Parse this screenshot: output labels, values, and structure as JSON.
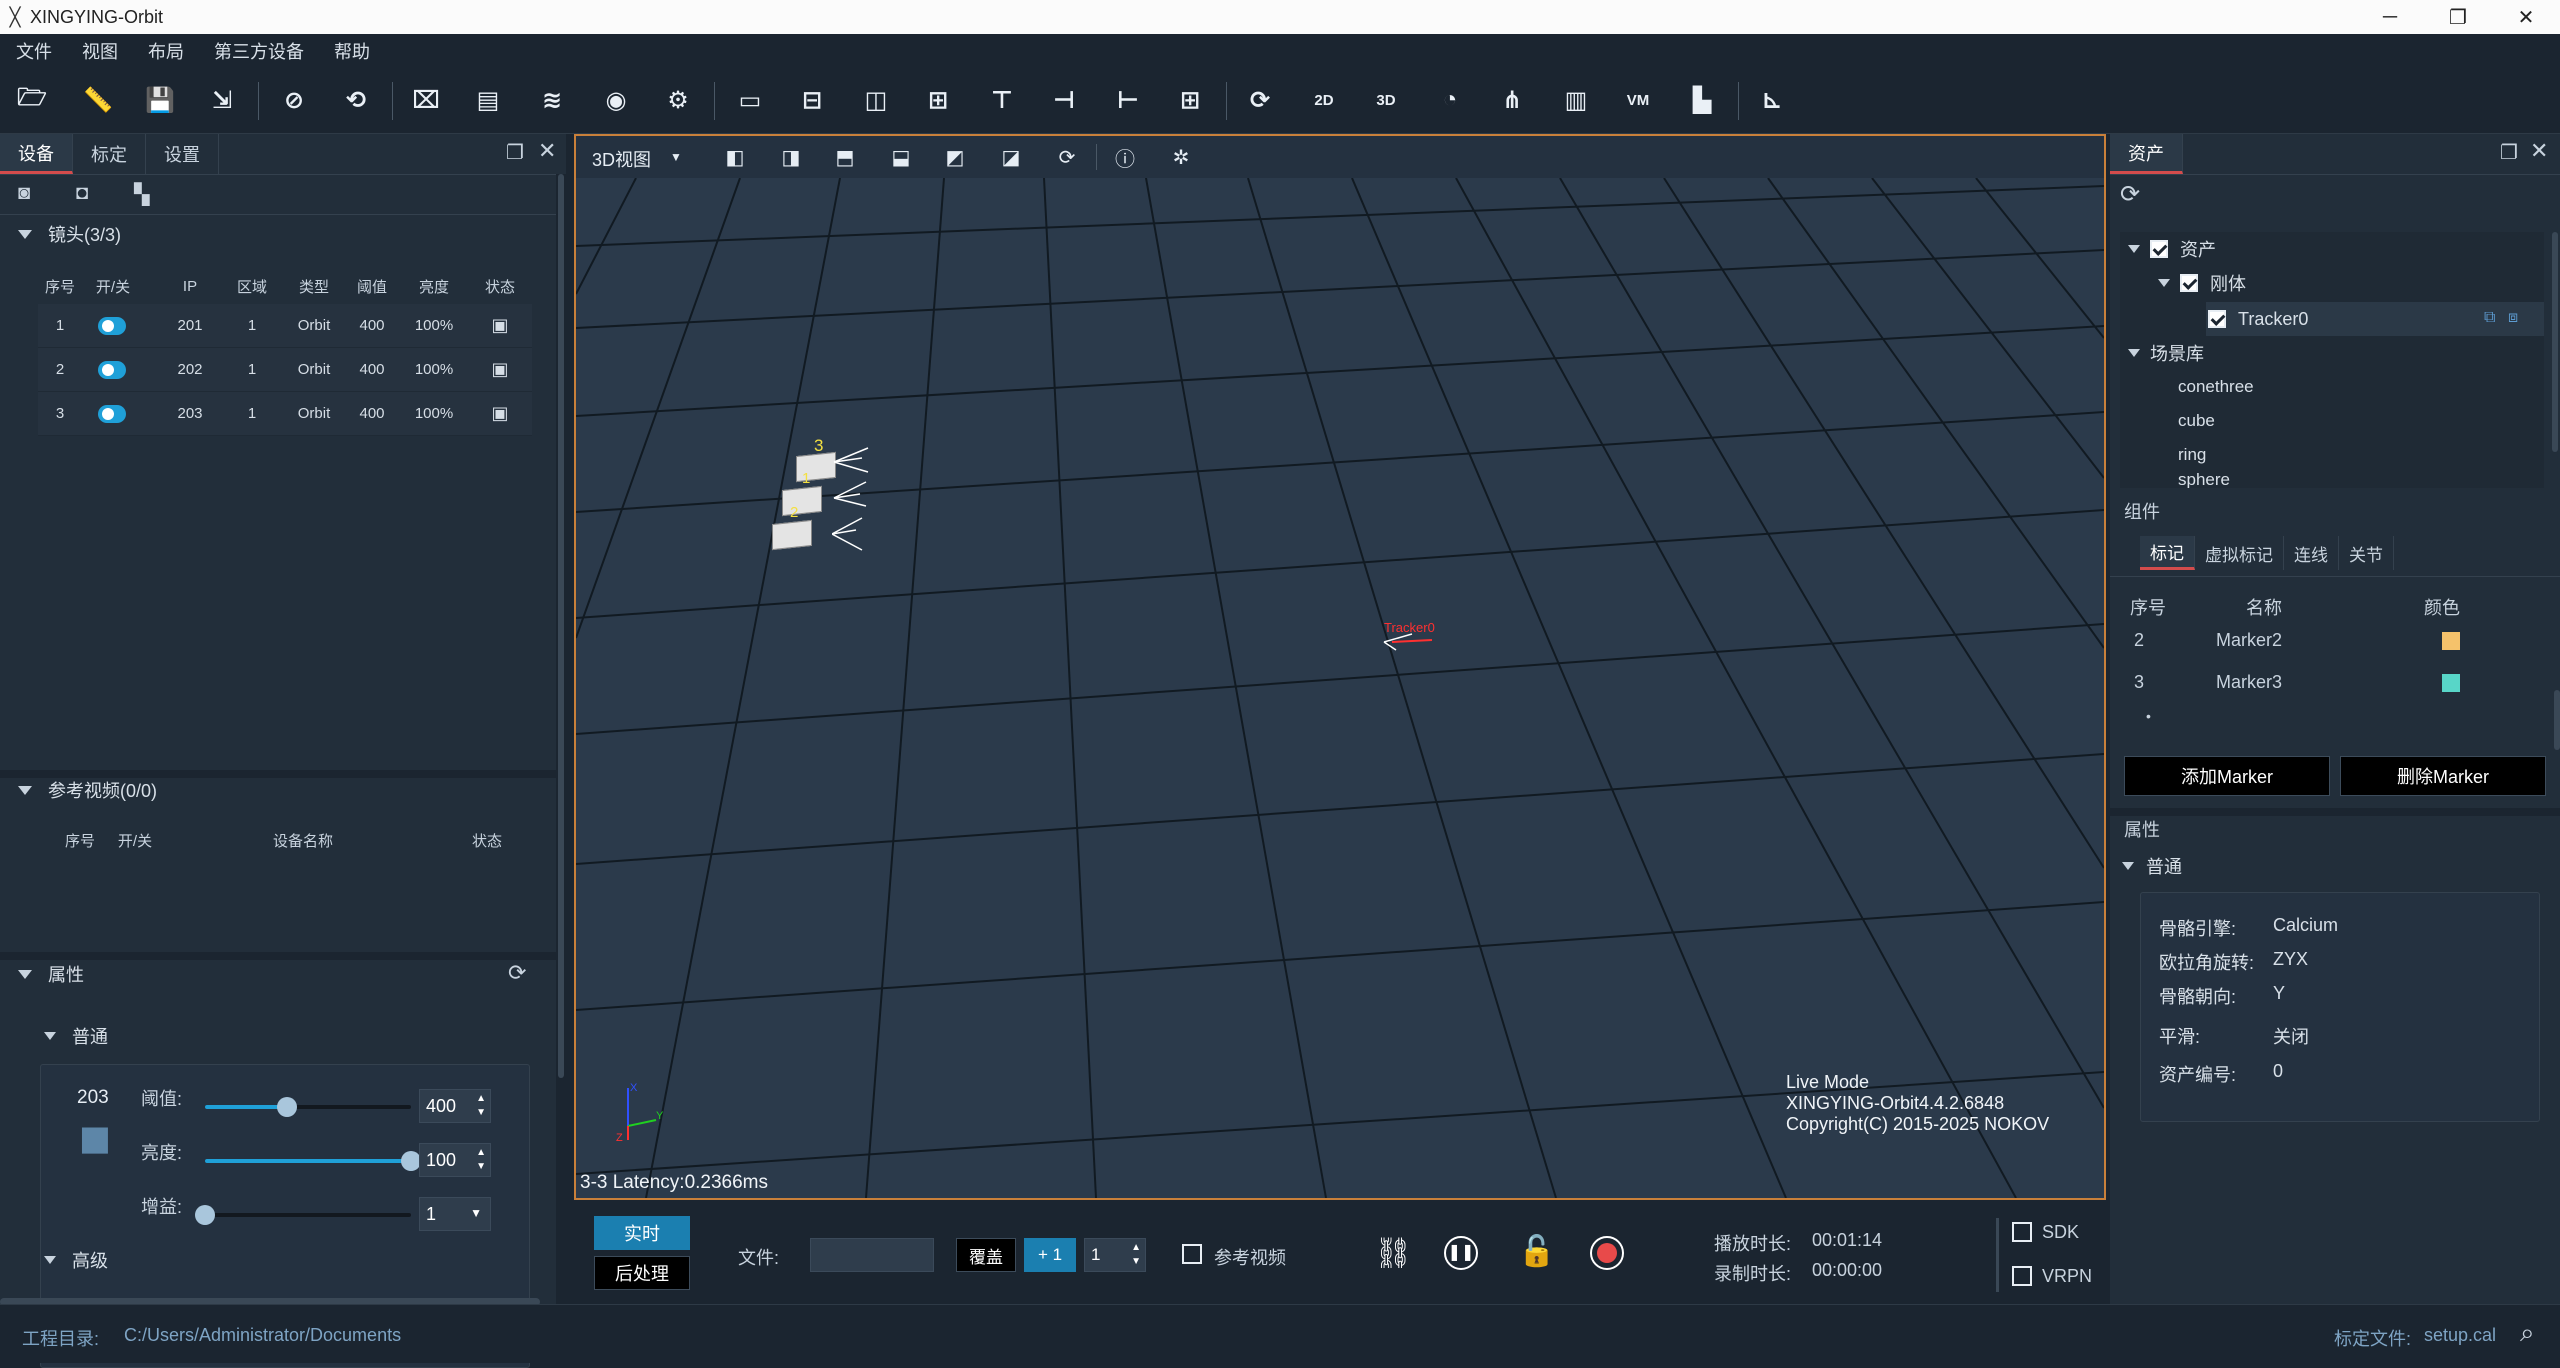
{
  "app": {
    "title": "XINGYING-Orbit"
  },
  "menu": [
    "文件",
    "视图",
    "布局",
    "第三方设备",
    "帮助"
  ],
  "toolbar_icons": [
    "open-folder-icon",
    "ruler-icon",
    "save-icon",
    "save-as-icon",
    "hide-icon",
    "rotate-device-icon",
    "camera-off-icon",
    "calibration-bar-icon",
    "layers-icon",
    "wireless-icon",
    "settings-icon",
    "layout-single-icon",
    "layout-split-h-icon",
    "layout-split-v-icon",
    "layout-grid-a-icon",
    "layout-grid-b-icon",
    "layout-grid-c-icon",
    "layout-grid-d-icon",
    "layout-quad-icon",
    "camera-refresh-icon",
    "view-2d-icon",
    "view-3d-icon",
    "gauge-icon",
    "graph-icon",
    "bar-chart-icon",
    "vm-icon",
    "file-icon",
    "axis-icon"
  ],
  "toolbar_text": {
    "view2d": "2D",
    "view3d": "3D",
    "vm": "VM"
  },
  "left": {
    "tabs": [
      "设备",
      "标定",
      "设置"
    ],
    "cameras_title": "镜头(3/3)",
    "cam_headers": [
      "序号",
      "开/关",
      "IP",
      "区域",
      "类型",
      "阈值",
      "亮度",
      "状态"
    ],
    "cameras": [
      {
        "no": "1",
        "ip": "201",
        "zone": "1",
        "type": "Orbit",
        "threshold": "400",
        "brightness": "100%"
      },
      {
        "no": "2",
        "ip": "202",
        "zone": "1",
        "type": "Orbit",
        "threshold": "400",
        "brightness": "100%"
      },
      {
        "no": "3",
        "ip": "203",
        "zone": "1",
        "type": "Orbit",
        "threshold": "400",
        "brightness": "100%"
      }
    ],
    "ref_title": "参考视频(0/0)",
    "ref_headers": [
      "序号",
      "开/关",
      "设备名称",
      "状态"
    ],
    "props_title": "属性",
    "general": "普通",
    "cam_id": "203",
    "threshold_label": "阈值:",
    "threshold_value": "400",
    "threshold_fraction": 0.4,
    "brightness_label": "亮度:",
    "brightness_value": "100",
    "brightness_fraction": 1.0,
    "gain_label": "增益:",
    "gain_value": "1",
    "gain_fraction": 0.0,
    "advanced": "高级"
  },
  "viewport": {
    "view_mode": "3D视图",
    "cam_labels": [
      "3",
      "1",
      "2"
    ],
    "tracker_label": "Tracker0",
    "axis_y": "Y",
    "axis_x": "X",
    "axis_z": "Z",
    "mode": "Live Mode",
    "version": "XINGYING-Orbit4.4.2.6848",
    "copyright": "Copyright(C) 2015-2025 NOKOV",
    "latency": "3-3 Latency:0.2366ms"
  },
  "bottom": {
    "realtime": "实时",
    "postprocess": "后处理",
    "file_label": "文件:",
    "overwrite": "覆盖",
    "plus1": "+ 1",
    "step": "1",
    "ref_video": "参考视频",
    "play_duration_label": "播放时长:",
    "play_duration": "00:01:14",
    "rec_duration_label": "录制时长:",
    "rec_duration": "00:00:00",
    "sdk": "SDK",
    "vrpn": "VRPN"
  },
  "right": {
    "tab": "资产",
    "tree": {
      "assets": "资产",
      "rigid": "刚体",
      "tracker": "Tracker0",
      "scene": "场景库",
      "scene_items": [
        "conethree",
        "cube",
        "ring",
        "sphere"
      ]
    },
    "component": "组件",
    "comp_tabs": [
      "标记",
      "虚拟标记",
      "连线",
      "关节"
    ],
    "marker_headers": [
      "序号",
      "名称",
      "颜色"
    ],
    "markers": [
      {
        "no": "2",
        "name": "Marker2",
        "color": "#f5c26b"
      },
      {
        "no": "3",
        "name": "Marker3",
        "color": "#58d6c8"
      }
    ],
    "add_marker": "添加Marker",
    "del_marker": "删除Marker",
    "props": "属性",
    "general": "普通",
    "prop_list": [
      {
        "label": "骨骼引擎:",
        "value": "Calcium"
      },
      {
        "label": "欧拉角旋转:",
        "value": "ZYX"
      },
      {
        "label": "骨骼朝向:",
        "value": "Y"
      },
      {
        "label": "平滑:",
        "value": "关闭"
      },
      {
        "label": "资产编号:",
        "value": "0"
      }
    ]
  },
  "status": {
    "project_label": "工程目录:",
    "project_path": "C:/Users/Administrator/Documents",
    "calib_label": "标定文件:",
    "calib_file": "setup.cal"
  }
}
